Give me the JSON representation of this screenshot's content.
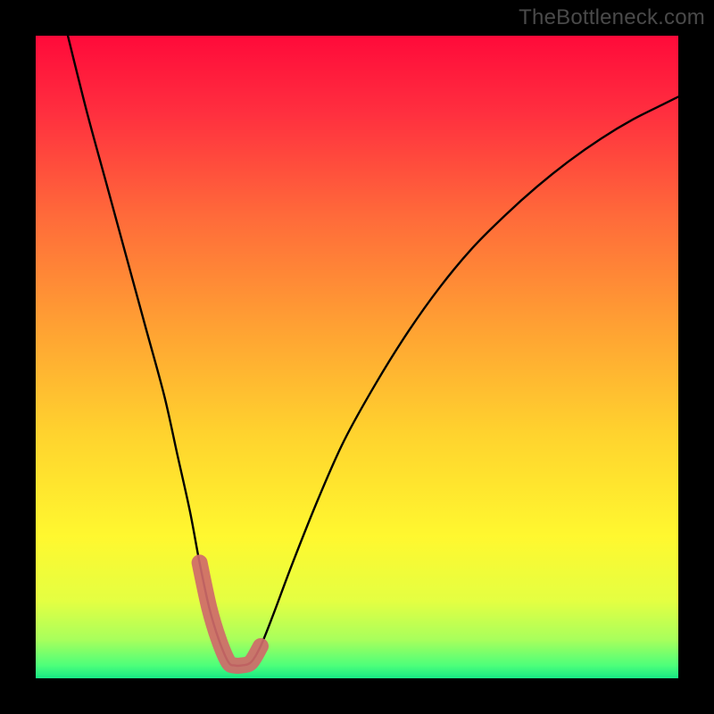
{
  "watermark": "TheBottleneck.com",
  "chart_data": {
    "type": "line",
    "title": "",
    "xlabel": "",
    "ylabel": "",
    "xlim": [
      0,
      100
    ],
    "ylim": [
      0,
      100
    ],
    "series": [
      {
        "name": "bottleneck-curve",
        "x": [
          5,
          8,
          11,
          14,
          17,
          20,
          22,
          24,
          25.5,
          27,
          28.5,
          30,
          31,
          32,
          33.5,
          35,
          37,
          40,
          44,
          48,
          53,
          58,
          63,
          68,
          73,
          78,
          83,
          88,
          93,
          98,
          100
        ],
        "y": [
          100,
          88,
          77,
          66,
          55,
          44,
          35,
          26,
          18,
          11,
          6,
          2.5,
          2,
          2,
          2.5,
          5,
          10,
          18,
          28,
          37,
          46,
          54,
          61,
          67,
          72,
          76.5,
          80.5,
          84,
          87,
          89.5,
          90.5
        ]
      }
    ],
    "highlight": {
      "name": "valley-marker",
      "color": "#cf6a6a",
      "x": [
        25.5,
        27,
        28.5,
        30,
        31,
        32,
        33.5,
        35
      ],
      "y": [
        18,
        11,
        6,
        2.5,
        2,
        2,
        2.5,
        5
      ]
    },
    "background_gradient": {
      "stops": [
        {
          "offset": 0.0,
          "color": "#ff0a3a"
        },
        {
          "offset": 0.12,
          "color": "#ff2f3f"
        },
        {
          "offset": 0.28,
          "color": "#ff6a3a"
        },
        {
          "offset": 0.45,
          "color": "#ffa033"
        },
        {
          "offset": 0.62,
          "color": "#ffd32e"
        },
        {
          "offset": 0.78,
          "color": "#fff82f"
        },
        {
          "offset": 0.88,
          "color": "#e4ff42"
        },
        {
          "offset": 0.94,
          "color": "#a8ff5c"
        },
        {
          "offset": 0.98,
          "color": "#4dff7a"
        },
        {
          "offset": 1.0,
          "color": "#17e884"
        }
      ]
    }
  }
}
